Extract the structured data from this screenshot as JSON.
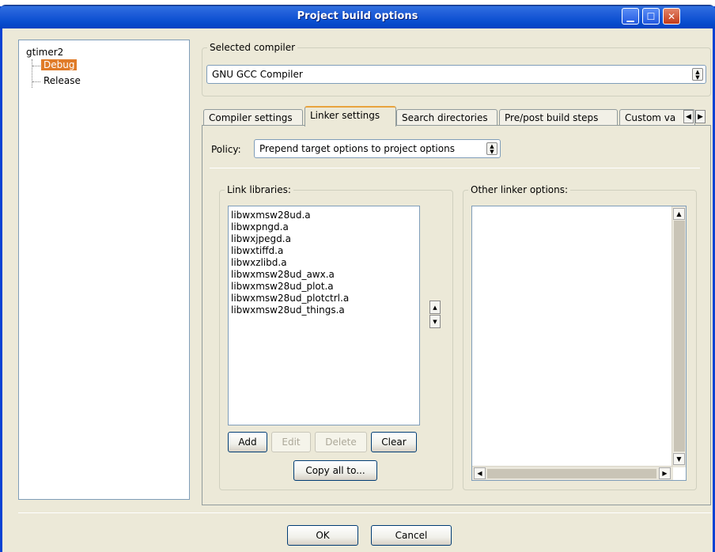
{
  "window": {
    "title": "Project build options",
    "minimize_glyph": "▁",
    "maximize_glyph": "☐",
    "close_glyph": "✕"
  },
  "tree": {
    "root": "gtimer2",
    "items": [
      {
        "label": "Debug",
        "selected": true
      },
      {
        "label": "Release",
        "selected": false
      }
    ]
  },
  "compiler": {
    "legend": "Selected compiler",
    "value": "GNU GCC Compiler"
  },
  "tabs": [
    {
      "label": "Compiler settings",
      "active": false
    },
    {
      "label": "Linker settings",
      "active": true
    },
    {
      "label": "Search directories",
      "active": false
    },
    {
      "label": "Pre/post build steps",
      "active": false
    },
    {
      "label": "Custom va",
      "active": false
    }
  ],
  "policy": {
    "label": "Policy:",
    "value": "Prepend target options to project options"
  },
  "link_libraries": {
    "legend": "Link libraries:",
    "items": [
      "libwxmsw28ud.a",
      "libwxpngd.a",
      "libwxjpegd.a",
      "libwxtiffd.a",
      "libwxzlibd.a",
      "libwxmsw28ud_awx.a",
      "libwxmsw28ud_plot.a",
      "libwxmsw28ud_plotctrl.a",
      "libwxmsw28ud_things.a"
    ],
    "buttons": {
      "add": "Add",
      "edit": "Edit",
      "delete": "Delete",
      "clear": "Clear",
      "copy_all": "Copy all to..."
    }
  },
  "other_linker": {
    "legend": "Other linker options:",
    "value": ""
  },
  "footer": {
    "ok": "OK",
    "cancel": "Cancel"
  },
  "icons": {
    "up": "▲",
    "down": "▼",
    "left": "◀",
    "right": "▶"
  },
  "colors": {
    "selection": "#E07B28",
    "titlebar": "#0A4FD0",
    "face": "#ECE9D8"
  }
}
